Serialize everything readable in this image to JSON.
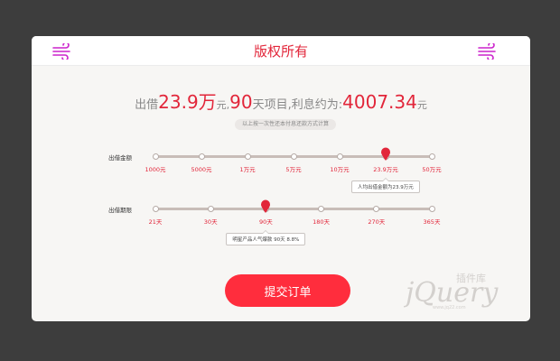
{
  "header": {
    "title": "版权所有"
  },
  "summary": {
    "prefix": "出借",
    "amount": "23.9万",
    "unit1": "元,",
    "days": "90",
    "middle": "天项目,利息约为:",
    "interest": "4007.34",
    "unit2": "元"
  },
  "note": "以上按一次性还本付息还款方式计算",
  "amount_slider": {
    "label": "出借金额",
    "ticks": [
      "1000元",
      "5000元",
      "1万元",
      "5万元",
      "10万元",
      "23.9万元",
      "50万元"
    ],
    "selected_index": 5,
    "tooltip": "人均出借金额为23.9万元"
  },
  "term_slider": {
    "label": "出借期限",
    "ticks": [
      "21天",
      "30天",
      "90天",
      "180天",
      "270天",
      "365天"
    ],
    "selected_index": 2,
    "tooltip": "明星产品人气爆款 90天 8.8%"
  },
  "submit_label": "提交订单",
  "watermark": {
    "logo_text": "jQuery",
    "brand": "插件库",
    "url": "www.jq22.com"
  },
  "colors": {
    "accent": "#e2263a",
    "button": "#ff2d3d",
    "background": "#3d3d3d",
    "icon": "#cc22cc"
  },
  "icons": {
    "header_left": "wind-icon",
    "header_right": "wind-icon",
    "slider_pin": "map-pin-icon"
  }
}
